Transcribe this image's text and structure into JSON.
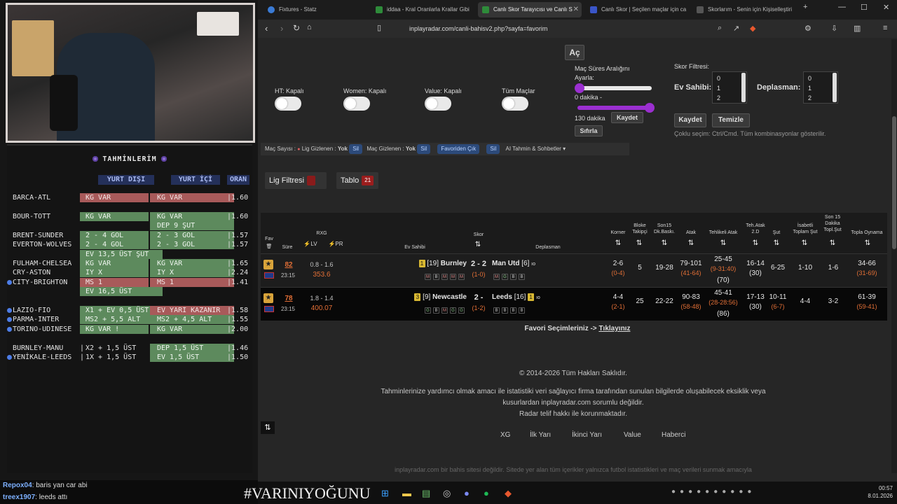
{
  "overlay": {
    "tips_title": "TAHMİNLERİM",
    "col_away": "YURT DIŞI",
    "col_home": "YURT İÇİ",
    "col_odds": "ORAN",
    "rows": [
      {
        "match": "BARCA-ATL",
        "c1": "KG VAR",
        "c2": "KG VAR",
        "odds": "1.60",
        "c1c": "red",
        "c2c": "red",
        "bullet": false
      },
      {
        "match": "BOUR-TOTT",
        "c1": "KG VAR",
        "c2": "KG VAR",
        "odds": "1.60",
        "c1c": "grn",
        "c2c": "grn",
        "bullet": false
      },
      {
        "match": "",
        "c1": "",
        "c2": "DEP 9 ŞUT",
        "odds": "",
        "c1c": "",
        "c2c": "grn",
        "bullet": false
      },
      {
        "match": "BRENT-SUNDER",
        "c1": "2 - 4 GOL",
        "c2": "2 - 3 GOL",
        "odds": "1.57",
        "c1c": "grn",
        "c2c": "grn",
        "bullet": false
      },
      {
        "match": "EVERTON-WOLVES",
        "c1": "2 - 4 GOL",
        "c2": "2 - 3 GOL",
        "odds": "1.57",
        "c1c": "grn",
        "c2c": "grn",
        "bullet": false
      },
      {
        "match": "",
        "c1": "EV 13,5 ÜST ŞUT",
        "c2": "",
        "odds": "",
        "c1c": "grn",
        "c2c": "",
        "bullet": false
      },
      {
        "match": "FULHAM-CHELSEA",
        "c1": "KG VAR",
        "c2": "KG VAR",
        "odds": "1.65",
        "c1c": "grn",
        "c2c": "grn",
        "bullet": false
      },
      {
        "match": "CRY-ASTON",
        "c1": "IY X",
        "c2": "IY X",
        "odds": "2.24",
        "c1c": "grn",
        "c2c": "grn",
        "bullet": false
      },
      {
        "match": "CITY-BRIGHTON",
        "c1": "MS 1",
        "c2": "MS 1",
        "odds": "1.41",
        "c1c": "red",
        "c2c": "red",
        "bullet": true
      },
      {
        "match": "",
        "c1": "EV 16,5 ÜST",
        "c2": "",
        "odds": "",
        "c1c": "grn",
        "c2c": "",
        "bullet": false
      },
      {
        "match": "LAZIO-FIO",
        "c1": "X1 + EV 0,5 ÜST",
        "c2": "EV YARI KAZANIR",
        "odds": "1.58",
        "c1c": "grn",
        "c2c": "red",
        "bullet": true
      },
      {
        "match": "PARMA-INTER",
        "c1": "MS2 + 5,5 ALT",
        "c2": "MS2 + 4,5 ALT",
        "odds": "1.55",
        "c1c": "grn",
        "c2c": "grn",
        "bullet": true
      },
      {
        "match": "TORINO-UDINESE",
        "c1": "KG VAR !",
        "c2": "KG VAR",
        "odds": "2.00",
        "c1c": "grn",
        "c2c": "grn",
        "bullet": true
      },
      {
        "match": "BURNLEY-MANU",
        "c1": "X2 + 1,5 ÜST",
        "c2": "DEP 1,5 ÜST",
        "odds": "1.46",
        "c1c": "",
        "c2c": "grn",
        "bullet": false
      },
      {
        "match": "YENİKALE-LEEDS",
        "c1": "1X + 1,5 ÜST",
        "c2": "EV 1,5 ÜST",
        "odds": "1.50",
        "c1c": "",
        "c2c": "grn",
        "bullet": true
      }
    ],
    "chat": [
      {
        "user": "Repox04",
        "msg": ": baris yan car abi"
      },
      {
        "user": "treex1907",
        "msg": ": leeds attı"
      }
    ],
    "hashtag": "#VARINIYOĞUNU"
  },
  "browser": {
    "tabs": [
      {
        "label": "Fixtures - Statz",
        "active": false,
        "color": "#3a7bd5"
      },
      {
        "label": "iddaa - Kral Oranlarla Krallar Gibi",
        "active": false,
        "color": "#2e8b3a"
      },
      {
        "label": "Canlı Skor Tarayıcısı ve Canlı S",
        "active": true,
        "color": "#2e8b3a"
      },
      {
        "label": "Canlı Skor | Seçilen maçlar için ca",
        "active": false,
        "color": "#3a55c8"
      },
      {
        "label": "Skorlarım - Senin için Kişiselleştiri",
        "active": false,
        "color": "#555555"
      }
    ],
    "url": "inplayradar.com/canli-bahisv2.php?sayfa=favorim"
  },
  "filters": {
    "ac_button": "Aç",
    "toggles": [
      {
        "label": "HT: Kapalı"
      },
      {
        "label": "Women: Kapalı"
      },
      {
        "label": "Value: Kapalı"
      },
      {
        "label": "Tüm Maçlar"
      }
    ],
    "duration_title": "Maç Süres Aralığını Ayarla:",
    "min_label": "0 dakika -",
    "max_label": "130 dakika",
    "save_label": "Kaydet",
    "reset_label": "Sıfırla",
    "score_filter_title": "Skor Filtresi:",
    "home_label": "Ev Sahibi:",
    "away_label": "Deplasman:",
    "home_options": [
      "0",
      "1",
      "2"
    ],
    "away_options": [
      "0",
      "1",
      "2"
    ],
    "save2": "Kaydet",
    "clear": "Temizle",
    "multi_hint": "Çoklu seçim: Ctrl/Cmd. Tüm kombinasyonlar gösterilir."
  },
  "bar": {
    "mac_sayisi": "Maç Sayısı :",
    "lig_gizlenen": "Lig Gizlenen :",
    "yok1": "Yok",
    "sil1": "Sil",
    "mac_gizlenen": "Maç Gizlenen :",
    "yok2": "Yok",
    "sil2": "Sil",
    "favori_cik": "Favoriden Çık",
    "sil3": "Sil",
    "ai": "AI Tahmin & Sohbetler"
  },
  "tabs2": {
    "lig_filtresi": "Lig Filtresi",
    "tablo": "Tablo",
    "tablo_count": "21"
  },
  "table": {
    "headers": {
      "fav": "Fav",
      "sure": "Süre",
      "rxg": "RXG",
      "lv": "LV",
      "pr": "PR",
      "ev": "Ev Sahibi",
      "skor": "Skor",
      "dep": "Deplasman",
      "korner": "Korner",
      "bloke": "Bloke Takipçi",
      "son15": "Son15 Dk.Baskı.",
      "atak": "Atak",
      "tehlikeli": "Tehlikeli Atak",
      "teh2d": "Teh.Atak 2.D",
      "sut": "Şut",
      "isabetli": "İsabetli Toplam Şut",
      "son15sut": "Son 15 Dakika Topl.Şut",
      "topla": "Topla Oynama"
    },
    "rows": [
      {
        "minute": "82",
        "time": "23:15",
        "rxg": "0.8 - 1.6",
        "rxg2": "353.6",
        "home_rank": "[19]",
        "home": "Burnley",
        "home_card": "1",
        "score": "2 - 2",
        "ht": "(1-0)",
        "away": "Man Utd",
        "away_rank": "[6]",
        "home_form": [
          "M",
          "B",
          "M",
          "M",
          "M"
        ],
        "away_form": [
          "M",
          "G",
          "B",
          "B"
        ],
        "korner": "2-6",
        "korner_ht": "(0-4)",
        "bloke": "5",
        "son15": "19-28",
        "atak": "79-101",
        "atak_ht": "(41-64)",
        "tehlikeli": "25-45",
        "tehlikeli2": "(9-31:40)",
        "tehlikeli3": "(70)",
        "teh2d": "16-14",
        "teh2d2": "(30)",
        "sut": "6-25",
        "isabetli": "1-10",
        "son15sut": "1-6",
        "topla": "34-66",
        "topla_ht": "(31-69)"
      },
      {
        "minute": "78",
        "time": "23:15",
        "rxg": "1.8 - 1.4",
        "rxg2": "400.07",
        "home_rank": "[9]",
        "home": "Newcastle",
        "home_card": "3",
        "score": "2 -",
        "ht": "(1-2)",
        "away": "Leeds",
        "away_rank": "[16]",
        "away_card": "1",
        "home_form": [
          "G",
          "B",
          "M",
          "G",
          "G"
        ],
        "away_form": [
          "B",
          "B",
          "B",
          "B"
        ],
        "korner": "4-4",
        "korner_ht": "(2-1)",
        "bloke": "25",
        "son15": "22-22",
        "atak": "90-83",
        "atak_ht": "(58-48)",
        "tehlikeli": "45-41",
        "tehlikeli2": "(28-28:56)",
        "tehlikeli3": "(86)",
        "teh2d": "17-13",
        "teh2d2": "(30)",
        "sut": "10-11",
        "sut2": "(6-7)",
        "isabetli": "4-4",
        "son15sut": "3-2",
        "topla": "61-39",
        "topla_ht": "(59-41)"
      }
    ]
  },
  "footer": {
    "favori": "Favori Seçimleriniz ->",
    "tiklayin": "Tıklayınız",
    "copyright": "© 2014-2026 Tüm Hakları Saklıdır.",
    "disclaimer1": "Tahminlerinize yardımcı olmak amacı ile istatistiki veri sağlayıcı firma tarafından sunulan bilgilerde oluşabilecek eksiklik veya",
    "disclaimer2": "kusurlardan inplayradar.com sorumlu değildir.",
    "disclaimer3": "Radar telif hakkı ile korunmaktadır.",
    "links": [
      "XG",
      "İlk Yarı",
      "İkinci Yarı",
      "Value",
      "Haberci"
    ],
    "bottom": "inplayradar.com bir bahis sitesi değildir. Sitede yer alan tüm içerikler yalnızca futbol istatistikleri ve maç verileri sunmak amacıyla"
  },
  "taskbar": {
    "time": "00:57",
    "date": "8.01.2026"
  }
}
